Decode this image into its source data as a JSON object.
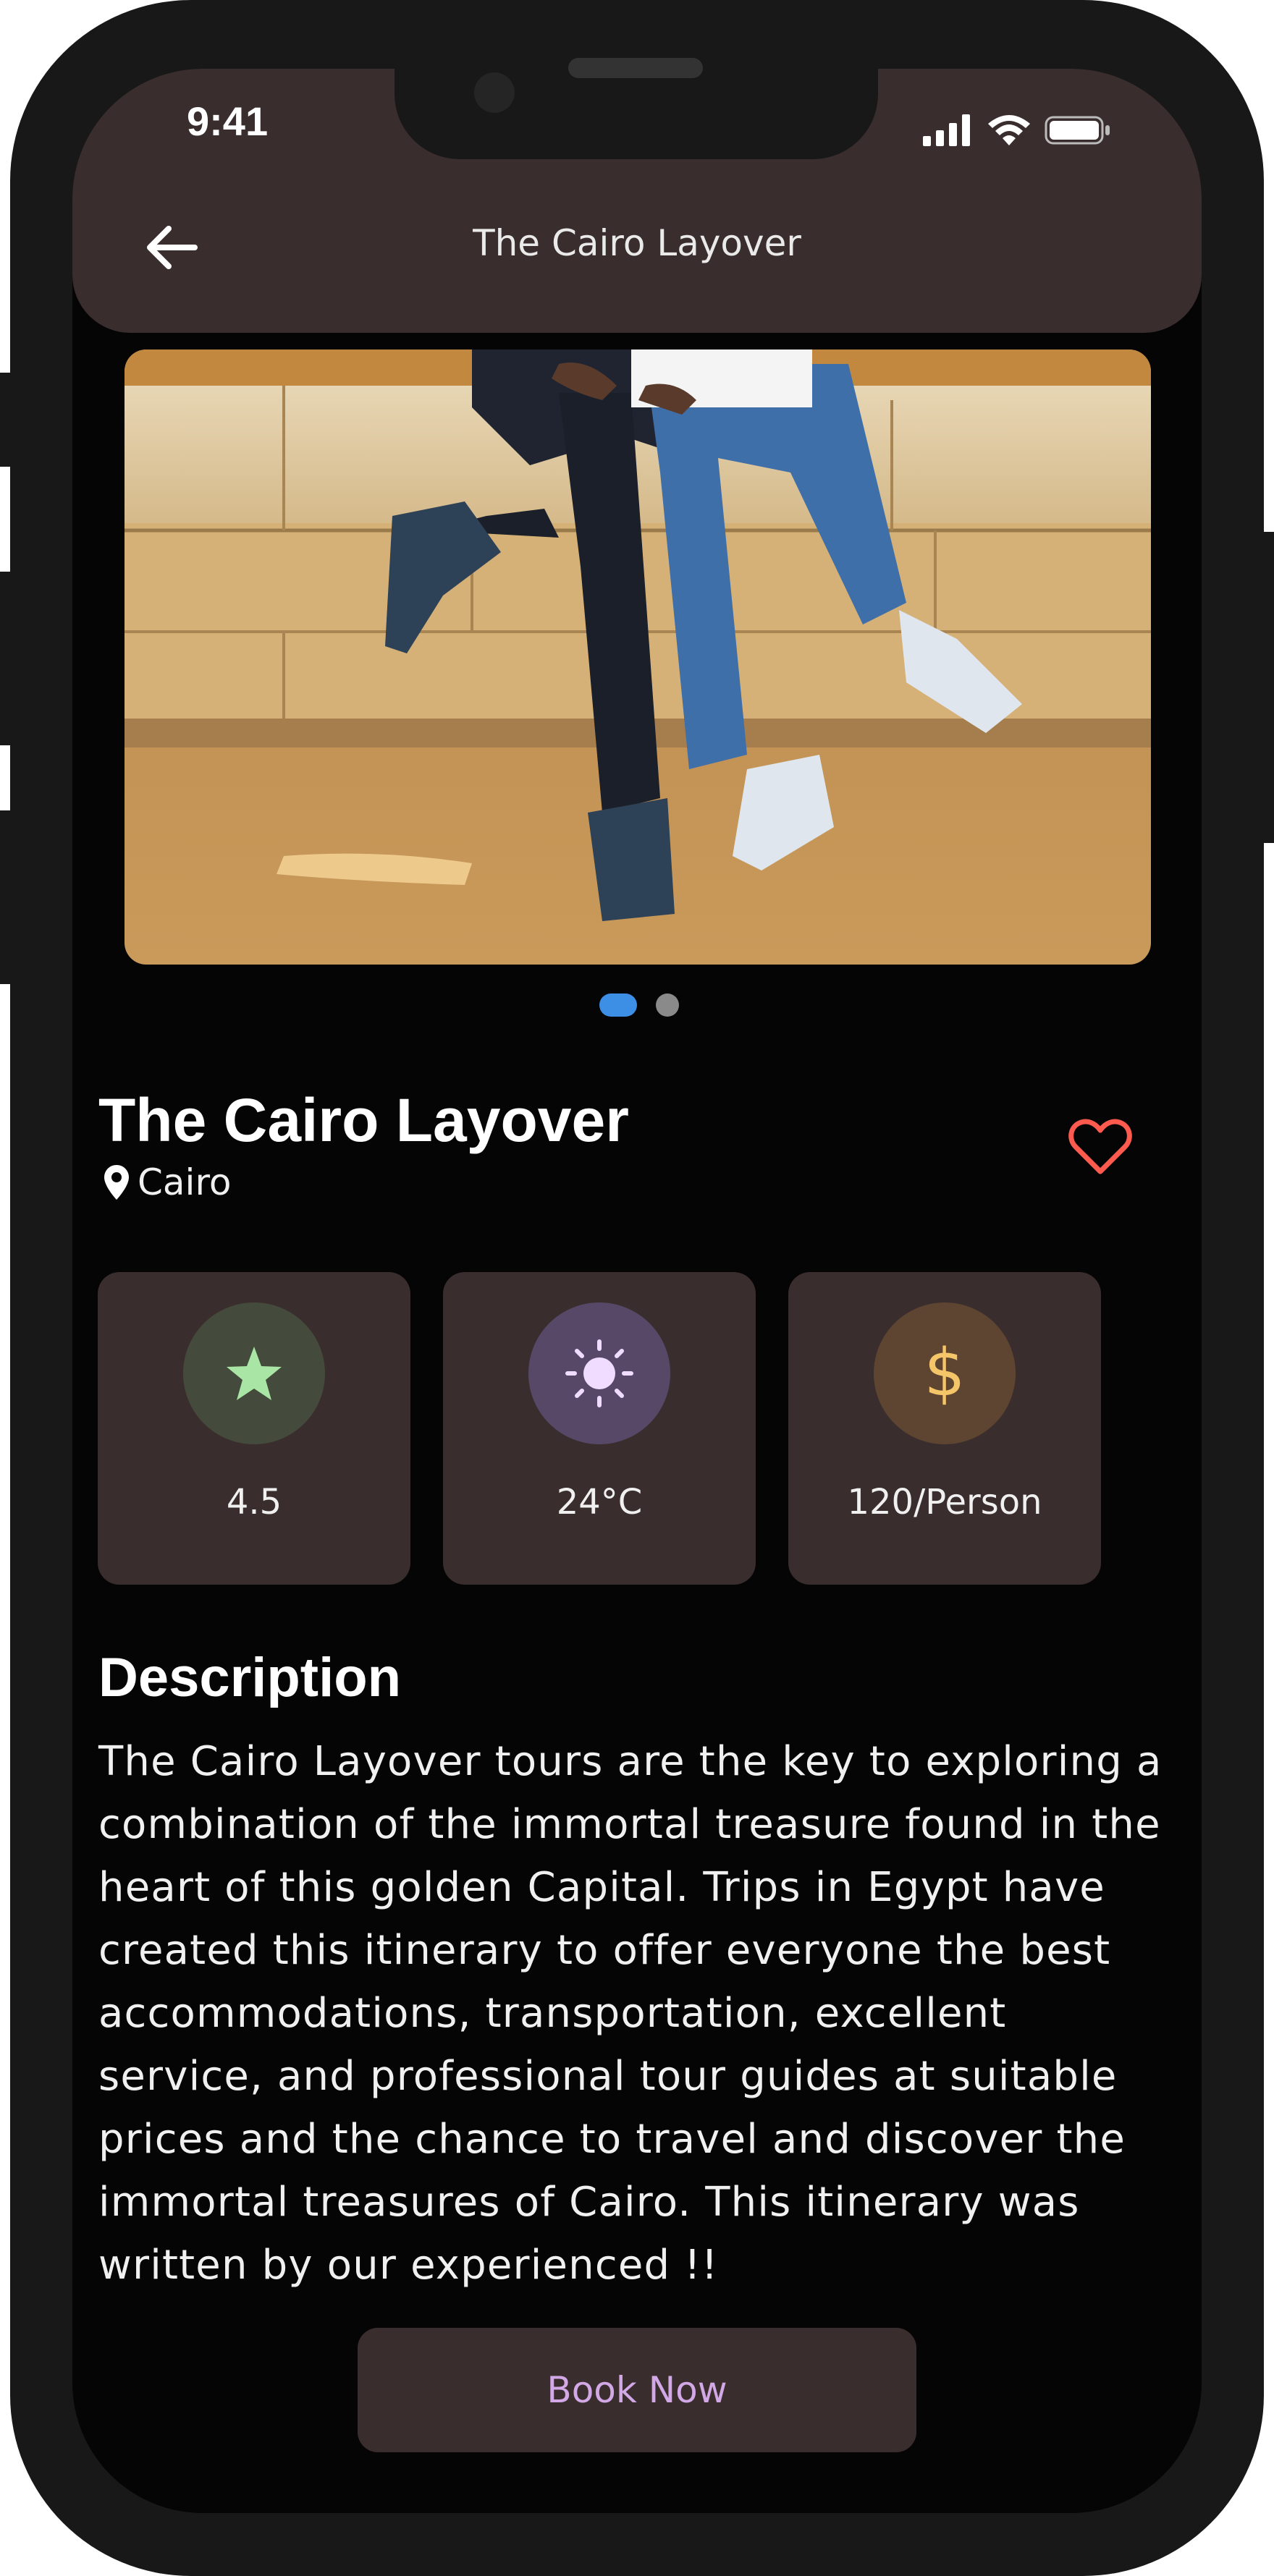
{
  "status_bar": {
    "time": "9:41"
  },
  "app_bar": {
    "title": "The Cairo Layover",
    "back_icon": "arrow-left-icon"
  },
  "carousel": {
    "pages": 2,
    "active_index": 0
  },
  "place": {
    "title": "The Cairo Layover",
    "location": "Cairo",
    "favorite_icon": "heart-outline-icon"
  },
  "stats": [
    {
      "icon": "star-icon",
      "value": "4.5",
      "circle_color": "#454b3c",
      "icon_color": "#a9e6a6"
    },
    {
      "icon": "sun-icon",
      "value": "24°C",
      "circle_color": "#574868",
      "icon_color": "#efdcff"
    },
    {
      "icon": "dollar-icon",
      "value": "120/Person",
      "circle_color": "#5e4531",
      "icon_color": "#f5c569"
    }
  ],
  "description": {
    "title": "Description",
    "text": "The Cairo Layover tours are the key to exploring a combination of the immortal treasure found in the heart of this golden Capital. Trips in Egypt have created this itinerary to offer everyone the best accommodations, transportation, excellent service, and professional tour guides at suitable prices and the chance to travel and discover the immortal treasures of Cairo. This itinerary was written by our experienced !!"
  },
  "book_button": {
    "label": "Book Now"
  },
  "colors": {
    "surface": "#3a2d2d",
    "background": "#050505",
    "accent_blue": "#3d8fe6",
    "heart": "#ff5a4e",
    "button_text": "#d2a8e6"
  }
}
